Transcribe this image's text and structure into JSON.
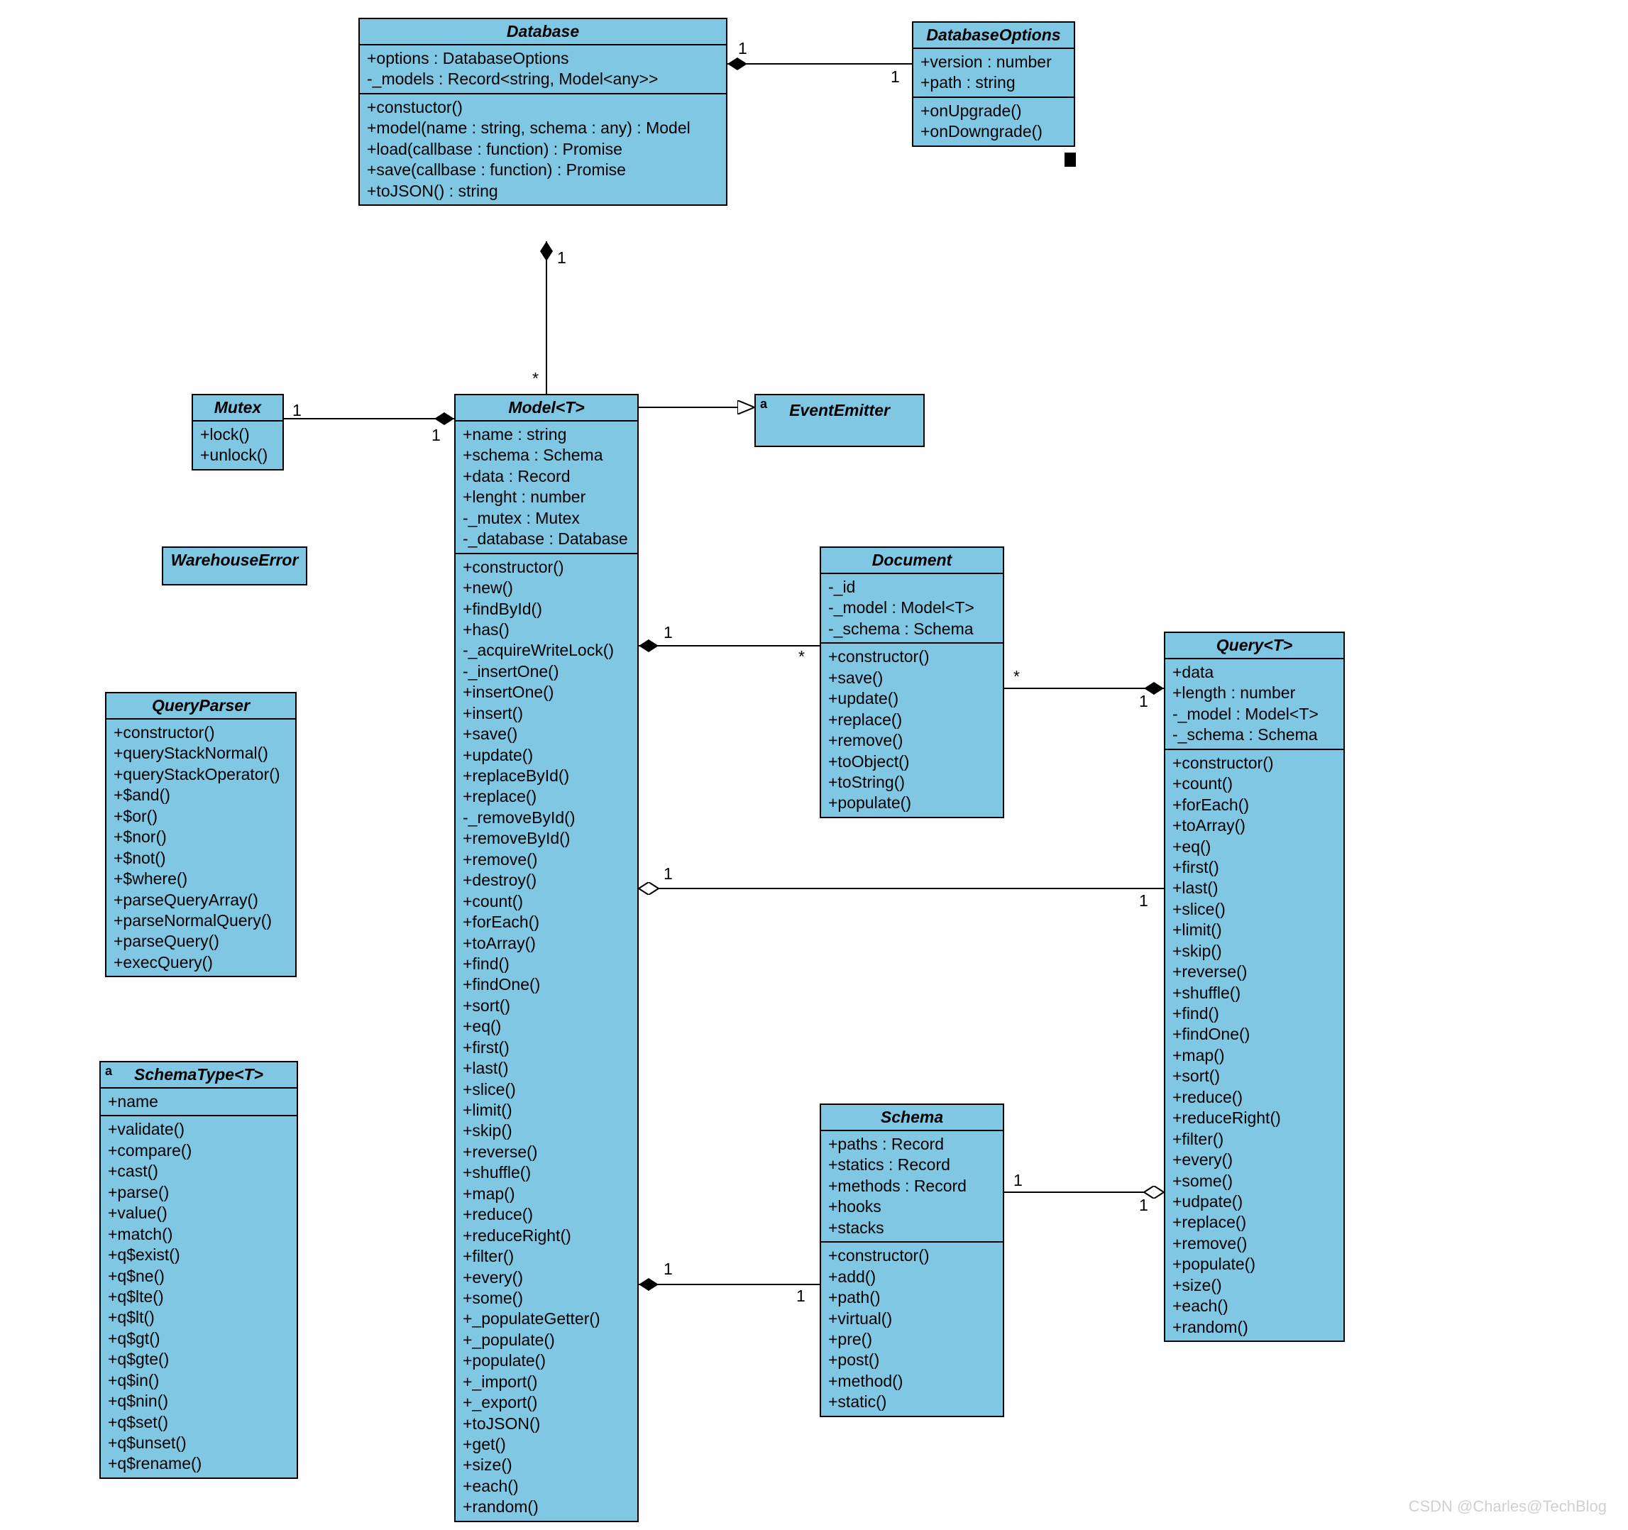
{
  "watermark": "CSDN @Charles@TechBlog",
  "classes": {
    "database": {
      "title": "Database",
      "attrs": [
        "+options : DatabaseOptions",
        "-_models : Record<string, Model<any>>"
      ],
      "ops": [
        "+constuctor()",
        "+model(name : string, schema : any) : Model",
        "+load(callbase : function) : Promise",
        "+save(callbase : function) : Promise",
        "+toJSON() : string"
      ]
    },
    "databaseOptions": {
      "title": "DatabaseOptions",
      "attrs": [
        "+version : number",
        "+path : string"
      ],
      "ops": [
        "+onUpgrade()",
        "+onDowngrade()"
      ]
    },
    "mutex": {
      "title": "Mutex",
      "ops": [
        "+lock()",
        "+unlock()"
      ]
    },
    "model": {
      "title": "Model<T>",
      "attrs": [
        "+name : string",
        "+schema : Schema",
        "+data : Record",
        "+lenght : number",
        "-_mutex : Mutex",
        "-_database : Database"
      ],
      "ops": [
        "+constructor()",
        "+new()",
        "+findById()",
        "+has()",
        "-_acquireWriteLock()",
        "-_insertOne()",
        "+insertOne()",
        "+insert()",
        "+save()",
        "+update()",
        "+replaceById()",
        "+replace()",
        "-_removeById()",
        "+removeById()",
        "+remove()",
        "+destroy()",
        "+count()",
        "+forEach()",
        "+toArray()",
        "+find()",
        "+findOne()",
        "+sort()",
        "+eq()",
        "+first()",
        "+last()",
        "+slice()",
        "+limit()",
        "+skip()",
        "+reverse()",
        "+shuffle()",
        "+map()",
        "+reduce()",
        "+reduceRight()",
        "+filter()",
        "+every()",
        "+some()",
        "+_populateGetter()",
        "+_populate()",
        "+populate()",
        "+_import()",
        "+_export()",
        "+toJSON()",
        "+get()",
        "+size()",
        "+each()",
        "+random()"
      ]
    },
    "eventEmitter": {
      "title": "EventEmitter"
    },
    "document": {
      "title": "Document",
      "attrs": [
        "-_id",
        "-_model : Model<T>",
        "-_schema : Schema"
      ],
      "ops": [
        "+constructor()",
        "+save()",
        "+update()",
        "+replace()",
        "+remove()",
        "+toObject()",
        "+toString()",
        "+populate()"
      ]
    },
    "query": {
      "title": "Query<T>",
      "attrs": [
        "+data",
        "+length : number",
        "-_model : Model<T>",
        "-_schema : Schema"
      ],
      "ops": [
        "+constructor()",
        "+count()",
        "+forEach()",
        "+toArray()",
        "+eq()",
        "+first()",
        "+last()",
        "+slice()",
        "+limit()",
        "+skip()",
        "+reverse()",
        "+shuffle()",
        "+find()",
        "+findOne()",
        "+map()",
        "+sort()",
        "+reduce()",
        "+reduceRight()",
        "+filter()",
        "+every()",
        "+some()",
        "+udpate()",
        "+replace()",
        "+remove()",
        "+populate()",
        "+size()",
        "+each()",
        "+random()"
      ]
    },
    "schema": {
      "title": "Schema",
      "attrs": [
        "+paths : Record",
        "+statics : Record",
        "+methods : Record",
        "+hooks",
        "+stacks"
      ],
      "ops": [
        "+constructor()",
        "+add()",
        "+path()",
        "+virtual()",
        "+pre()",
        "+post()",
        "+method()",
        "+static()"
      ]
    },
    "warehouseError": {
      "title": "WarehouseError"
    },
    "queryParser": {
      "title": "QueryParser",
      "ops": [
        "+constructor()",
        "+queryStackNormal()",
        "+queryStackOperator()",
        "+$and()",
        "+$or()",
        "+$nor()",
        "+$not()",
        "+$where()",
        "+parseQueryArray()",
        "+parseNormalQuery()",
        "+parseQuery()",
        "+execQuery()"
      ]
    },
    "schemaType": {
      "title": "SchemaType<T>",
      "attrs": [
        "+name"
      ],
      "ops": [
        "+validate()",
        "+compare()",
        "+cast()",
        "+parse()",
        "+value()",
        "+match()",
        "+q$exist()",
        "+q$ne()",
        "+q$lte()",
        "+q$lt()",
        "+q$gt()",
        "+q$gte()",
        "+q$in()",
        "+q$nin()",
        "+q$set()",
        "+q$unset()",
        "+q$rename()"
      ]
    }
  },
  "mults": {
    "db_opts_db": "1",
    "db_opts_opts": "1",
    "db_model_db": "1",
    "db_model_model": "*",
    "model_mutex_model": "1",
    "model_mutex_mutex": "1",
    "model_doc_model": "1",
    "model_doc_doc": "*",
    "model_query_model": "1",
    "model_query_query": "1",
    "model_schema_model": "1",
    "model_schema_schema": "1",
    "doc_query_doc": "*",
    "doc_query_query": "1",
    "schema_query_schema": "1",
    "schema_query_query": "1"
  },
  "alabels": {
    "eventEmitter": "a",
    "schemaType": "a"
  }
}
